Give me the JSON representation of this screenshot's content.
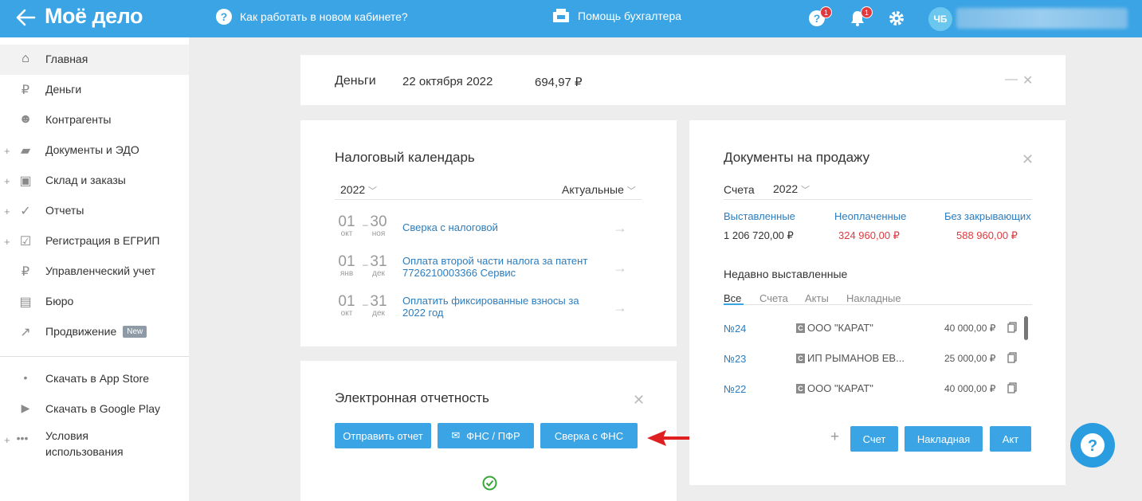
{
  "header": {
    "logo": "Моё дело",
    "howto": "Как работать в новом кабинете?",
    "accountant_help": "Помощь бухгалтера",
    "help_badge": "1",
    "bell_badge": "1",
    "avatar": "ЧБ"
  },
  "sidebar": {
    "items": [
      {
        "label": "Главная",
        "icon": "home-icon",
        "plus": false
      },
      {
        "label": "Деньги",
        "icon": "money-icon",
        "plus": false
      },
      {
        "label": "Контрагенты",
        "icon": "contractors-icon",
        "plus": false
      },
      {
        "label": "Документы и ЭДО",
        "icon": "folder-icon",
        "plus": true
      },
      {
        "label": "Склад и заказы",
        "icon": "cart-icon",
        "plus": true
      },
      {
        "label": "Отчеты",
        "icon": "report-icon",
        "plus": true
      },
      {
        "label": "Регистрация в ЕГРИП",
        "icon": "registration-icon",
        "plus": true
      },
      {
        "label": "Управленческий учет",
        "icon": "ruble-icon",
        "plus": false
      },
      {
        "label": "Бюро",
        "icon": "briefcase-icon",
        "plus": false
      },
      {
        "label": "Продвижение",
        "icon": "chart-icon",
        "plus": false,
        "badge": "New"
      }
    ],
    "extra": [
      {
        "label": "Скачать в App Store",
        "icon": "apple-icon"
      },
      {
        "label": "Скачать в Google Play",
        "icon": "play-icon"
      },
      {
        "label_line1": "Условия",
        "label_line2": "использования",
        "icon": "dots-icon"
      }
    ]
  },
  "money": {
    "title": "Деньги",
    "date": "22 октября 2022",
    "amount": "694,97 ₽"
  },
  "tax": {
    "title": "Налоговый календарь",
    "year": "2022",
    "filter": "Актуальные",
    "rows": [
      {
        "from_d": "01",
        "from_m": "окт",
        "to_d": "30",
        "to_m": "ноя",
        "text": "Сверка с налоговой"
      },
      {
        "from_d": "01",
        "from_m": "янв",
        "to_d": "31",
        "to_m": "дек",
        "text": "Оплата второй части налога за патент 7726210003366 Сервис"
      },
      {
        "from_d": "01",
        "from_m": "окт",
        "to_d": "31",
        "to_m": "дек",
        "text": "Оплатить фиксированные взносы за 2022 год"
      }
    ]
  },
  "reports": {
    "title": "Электронная отчетность",
    "send": "Отправить отчет",
    "fns": "ФНС / ПФР",
    "sverka": "Сверка с ФНС"
  },
  "sales": {
    "title": "Документы на продажу",
    "type": "Счета",
    "year": "2022",
    "stats": [
      {
        "label": "Выставленные",
        "value": "1 206 720,00 ₽"
      },
      {
        "label": "Неоплаченные",
        "value": "324 960,00 ₽"
      },
      {
        "label": "Без закрывающих",
        "value": "588 960,00 ₽"
      }
    ],
    "recent": "Недавно выставленные",
    "tabs": [
      "Все",
      "Счета",
      "Акты",
      "Накладные"
    ],
    "docs": [
      {
        "num": "№24",
        "name": "ООО \"КАРАТ\"",
        "sum": "40 000,00 ₽"
      },
      {
        "num": "№23",
        "name": "ИП РЫМАНОВ ЕВ...",
        "sum": "25 000,00 ₽"
      },
      {
        "num": "№22",
        "name": "ООО \"КАРАТ\"",
        "sum": "40 000,00 ₽"
      }
    ],
    "btn_invoice": "Счет",
    "btn_waybill": "Накладная",
    "btn_act": "Акт"
  },
  "colors": {
    "accent": "#3ba4e4",
    "link": "#2b7dbf",
    "danger": "#e0393e",
    "annotation": "#e02020"
  }
}
